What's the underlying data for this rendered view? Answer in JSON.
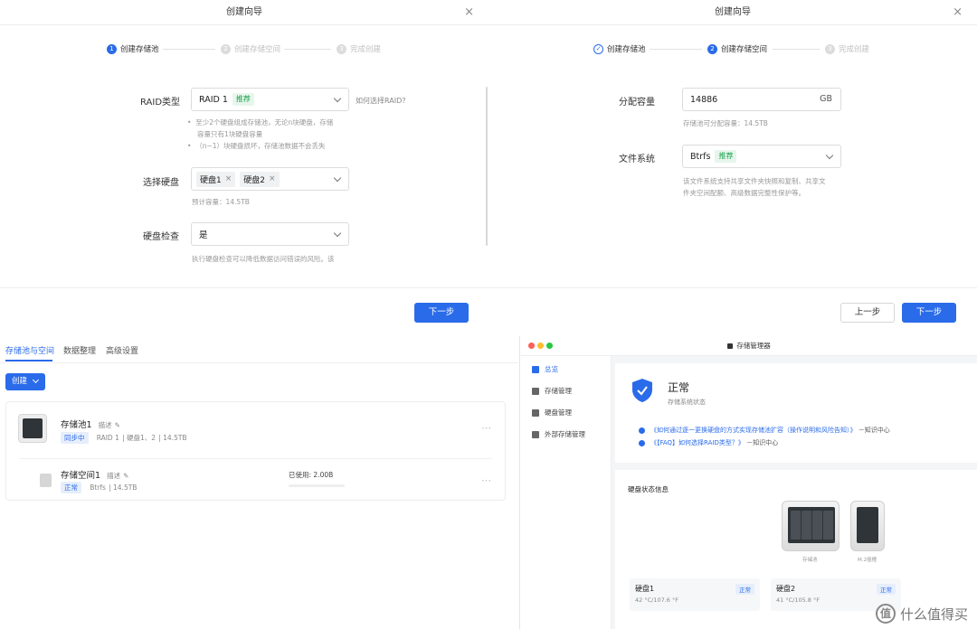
{
  "wizard1": {
    "title": "创建向导",
    "close": "×",
    "steps": [
      {
        "num": "1",
        "label": "创建存储池"
      },
      {
        "num": "2",
        "label": "创建存储空间"
      },
      {
        "num": "3",
        "label": "完成创建"
      }
    ],
    "raid_label": "RAID类型",
    "raid_value": "RAID 1",
    "raid_tag": "推荐",
    "raid_help_link": "如何选择RAID?",
    "raid_hints": [
      "至少2个硬盘组成存储池，无论n块硬盘，存储",
      "容量只有1块硬盘容量",
      "（n−1）块硬盘损坏，存储池数据不会丢失"
    ],
    "disk_label": "选择硬盘",
    "disk_chips": [
      "硬盘1",
      "硬盘2"
    ],
    "chip_remove": "×",
    "disk_capacity": "预计容量：14.5TB",
    "check_label": "硬盘检查",
    "check_value": "是",
    "check_hints": [
      "执行硬盘检查可以降低数据访问错误的风险。该"
    ],
    "next_button": "下一步"
  },
  "wizard2": {
    "title": "创建向导",
    "close": "×",
    "steps": [
      {
        "num": "✓",
        "label": "创建存储池"
      },
      {
        "num": "2",
        "label": "创建存储空间"
      },
      {
        "num": "3",
        "label": "完成创建"
      }
    ],
    "alloc_label": "分配容量",
    "alloc_value": "14886",
    "alloc_unit": "GB",
    "alloc_hint": "存储池可分配容量：14.5TB",
    "fs_label": "文件系统",
    "fs_value": "Btrfs",
    "fs_tag": "推荐",
    "fs_hints": [
      "该文件系统支持共享文件夹快照和复制、共享文",
      "件夹空间配额、高级数据完整性保护等。"
    ],
    "prev_button": "上一步",
    "next_button": "下一步"
  },
  "pool_panel": {
    "tabs": [
      "存储池与空间",
      "数据整理",
      "高级设置"
    ],
    "create_button": "创建",
    "pool": {
      "name": "存储池1",
      "desc": "描述",
      "status": "同步中",
      "raid": "RAID 1",
      "disks": "硬盘1、2",
      "size": "14.5TB"
    },
    "volume": {
      "name": "存储空间1",
      "desc": "描述",
      "status": "正常",
      "fs": "Btrfs",
      "size": "14.5TB",
      "used": "已使用: 2.00B"
    },
    "more": "⋯"
  },
  "manager": {
    "app_title": "存储管理器",
    "sidebar": [
      "总览",
      "存储管理",
      "硬盘管理",
      "外部存储管理"
    ],
    "status_title": "正常",
    "status_sub": "存储系统状态",
    "info_links": [
      {
        "text": "《如何通过逐一更换硬盘的方式实现存储池扩容（操作说明和风险告知）》",
        "src": "－知识中心"
      },
      {
        "text": "《【FAQ】如何选择RAID类型？》",
        "src": "－知识中心"
      }
    ],
    "disk_status_title": "硬盘状态信息",
    "nas_captions": [
      "存储池",
      "M.2插槽"
    ],
    "disks": [
      {
        "name": "硬盘1",
        "temp": "42 °C/107.6 °F",
        "status": "正常"
      },
      {
        "name": "硬盘2",
        "temp": "41 °C/105.8 °F",
        "status": "正常"
      }
    ]
  },
  "watermark": {
    "logo": "值",
    "text": "什么值得买"
  },
  "colors": {
    "accent": "#2a6bea",
    "success": "#1a9f4b"
  }
}
